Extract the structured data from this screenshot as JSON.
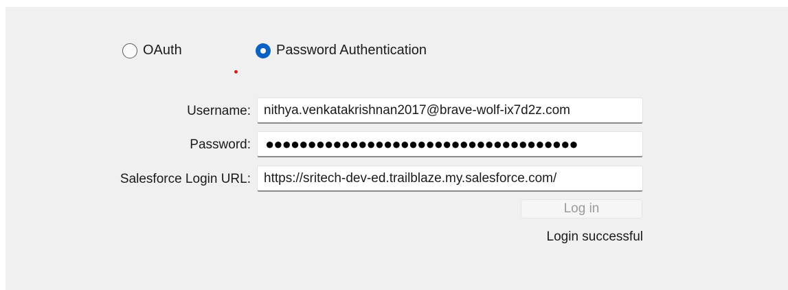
{
  "auth_options": {
    "oauth_label": "OAuth",
    "password_label": "Password Authentication",
    "selected": "password"
  },
  "form": {
    "username_label": "Username:",
    "username_value": "nithya.venkatakrishnan2017@brave-wolf-ix7d2z.com",
    "password_label": "Password:",
    "password_mask": "●●●●●●●●●●●●●●●●●●●●●●●●●●●●●●●●●●●●●",
    "url_label": "Salesforce Login URL:",
    "url_value": "https://sritech-dev-ed.trailblaze.my.salesforce.com/"
  },
  "login_button_label": "Log in",
  "status_message": "Login successful",
  "colors": {
    "radio_selected": "#0a63c4",
    "marker_dot": "#e01b1b"
  }
}
